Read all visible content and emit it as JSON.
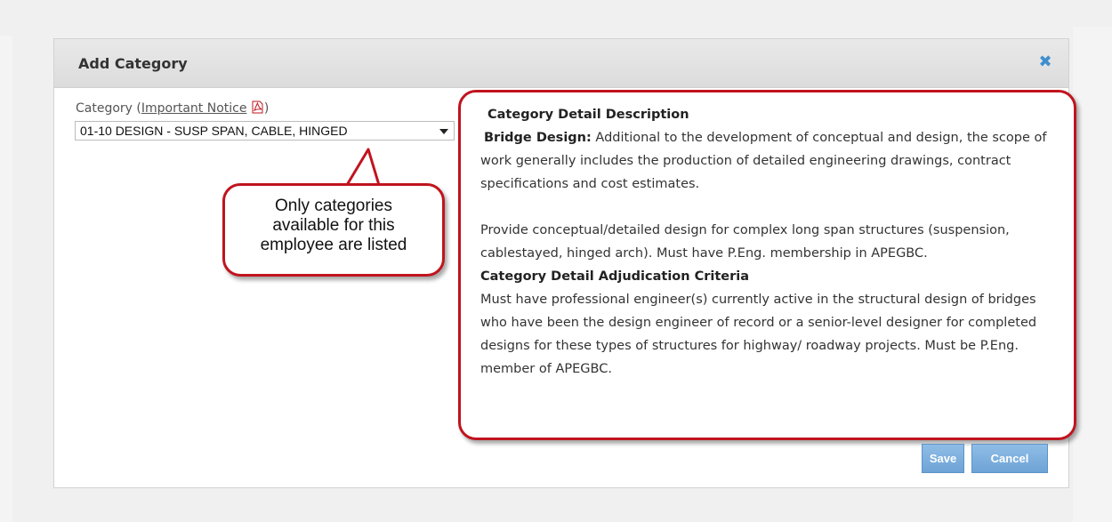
{
  "dialog": {
    "title": "Add Category",
    "close_icon": "close-icon"
  },
  "form": {
    "category_label": "Category (",
    "notice_link": "Important Notice",
    "category_label_end": ")",
    "pdf_icon": "pdf-icon",
    "category_value": "01-10 DESIGN - SUSP SPAN, CABLE, HINGED"
  },
  "callout": {
    "lines": [
      "Only categories",
      "available for this",
      "employee are listed"
    ]
  },
  "detail": {
    "description_heading": "Category Detail Description",
    "bridge_label": "Bridge Design:",
    "bridge_text": " Additional to the development of conceptual and design, the scope of work generally includes the production of detailed engineering drawings, contract specifications and cost estimates.",
    "provide_text": "Provide conceptual/detailed design for complex long span structures (suspension, cablestayed, hinged arch). Must have P.Eng. membership in APEGBC.",
    "criteria_heading": "Category Detail Adjudication Criteria",
    "criteria_text": "Must have professional engineer(s) currently active in the structural design of bridges who have been the design engineer of record or a senior-level designer for completed designs for these types of structures for highway/ roadway projects. Must be P.Eng. member of APEGBC."
  },
  "buttons": {
    "save": "Save",
    "cancel": "Cancel"
  },
  "colors": {
    "accent": "#6ea3d6",
    "callout_border": "#c0141e",
    "close_icon": "#3d8fcf"
  }
}
